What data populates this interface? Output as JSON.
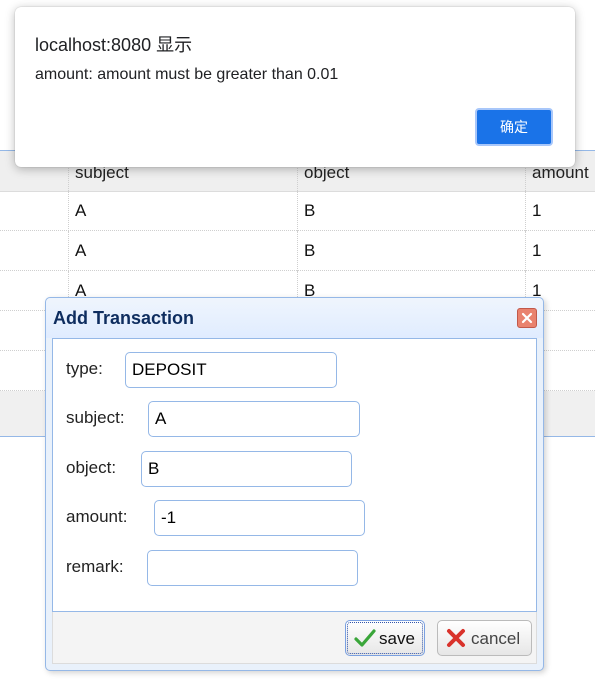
{
  "alert": {
    "title": "localhost:8080 显示",
    "message": "amount: amount must be greater than 0.01",
    "ok_label": "确定"
  },
  "grid": {
    "columns": [
      "",
      "subject",
      "object",
      "amount"
    ],
    "rows": [
      [
        "",
        "A",
        "B",
        "1"
      ],
      [
        "",
        "A",
        "B",
        "1"
      ],
      [
        "",
        "A",
        "B",
        "1"
      ],
      [
        "",
        "",
        "",
        ""
      ],
      [
        "",
        "",
        "",
        ""
      ]
    ]
  },
  "dialog": {
    "title": "Add Transaction",
    "fields": {
      "type": {
        "label": "type:",
        "value": "DEPOSIT"
      },
      "subject": {
        "label": "subject:",
        "value": "A"
      },
      "object": {
        "label": "object:",
        "value": "B"
      },
      "amount": {
        "label": "amount:",
        "value": "-1"
      },
      "remark": {
        "label": "remark:",
        "value": ""
      }
    },
    "save_label": "save",
    "cancel_label": "cancel"
  },
  "colors": {
    "accent": "#1a73e8",
    "panel_border": "#95b8e7",
    "dialog_title": "#0e2d5f",
    "save_check": "#3aa63a",
    "cancel_x": "#d9322b"
  },
  "icons": {
    "close": "close-icon",
    "save": "check-icon",
    "cancel": "cancel-icon"
  }
}
